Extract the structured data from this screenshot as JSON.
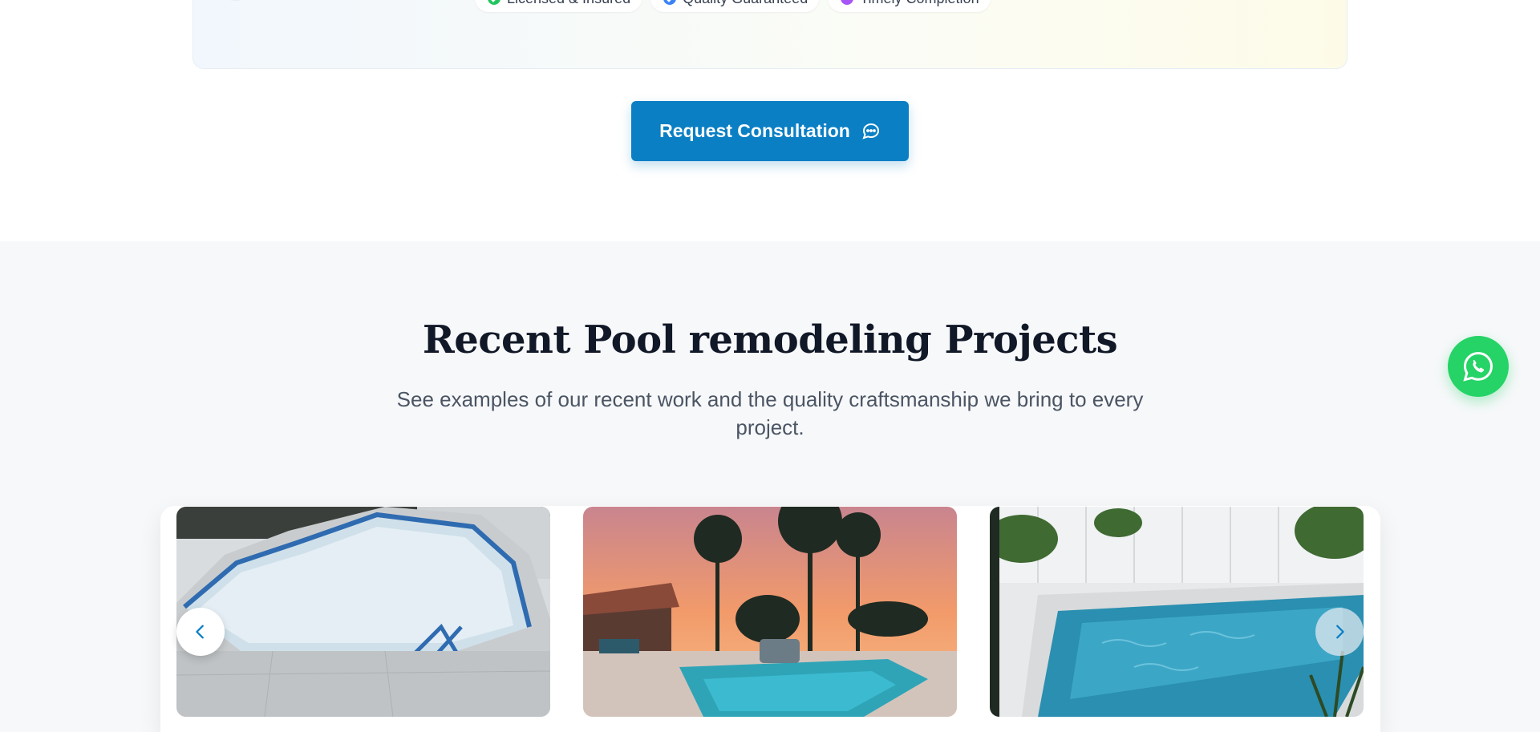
{
  "trust_badges": [
    {
      "label": "Licensed & Insured",
      "icon": "check-circle-icon",
      "color": "#22c55e"
    },
    {
      "label": "Quality Guaranteed",
      "icon": "verified-badge-icon",
      "color": "#3b82f6"
    },
    {
      "label": "Timely Completion",
      "icon": "clock-icon",
      "color": "#a855f7"
    }
  ],
  "cta": {
    "label": "Request Consultation",
    "icon": "chat-bubble-icon",
    "color": "#0a7fc4"
  },
  "projects": {
    "title": "Recent Pool remodeling Projects",
    "subtitle": "See examples of our recent work and the quality craftsmanship we bring to every project.",
    "slides": [
      {
        "icon": "empty-pool-photo"
      },
      {
        "icon": "sunset-pool-photo"
      },
      {
        "icon": "blue-pool-photo"
      }
    ],
    "prev_icon": "chevron-left-icon",
    "next_icon": "chevron-right-icon"
  },
  "floating": {
    "icon": "whatsapp-icon",
    "color": "#25d366"
  }
}
